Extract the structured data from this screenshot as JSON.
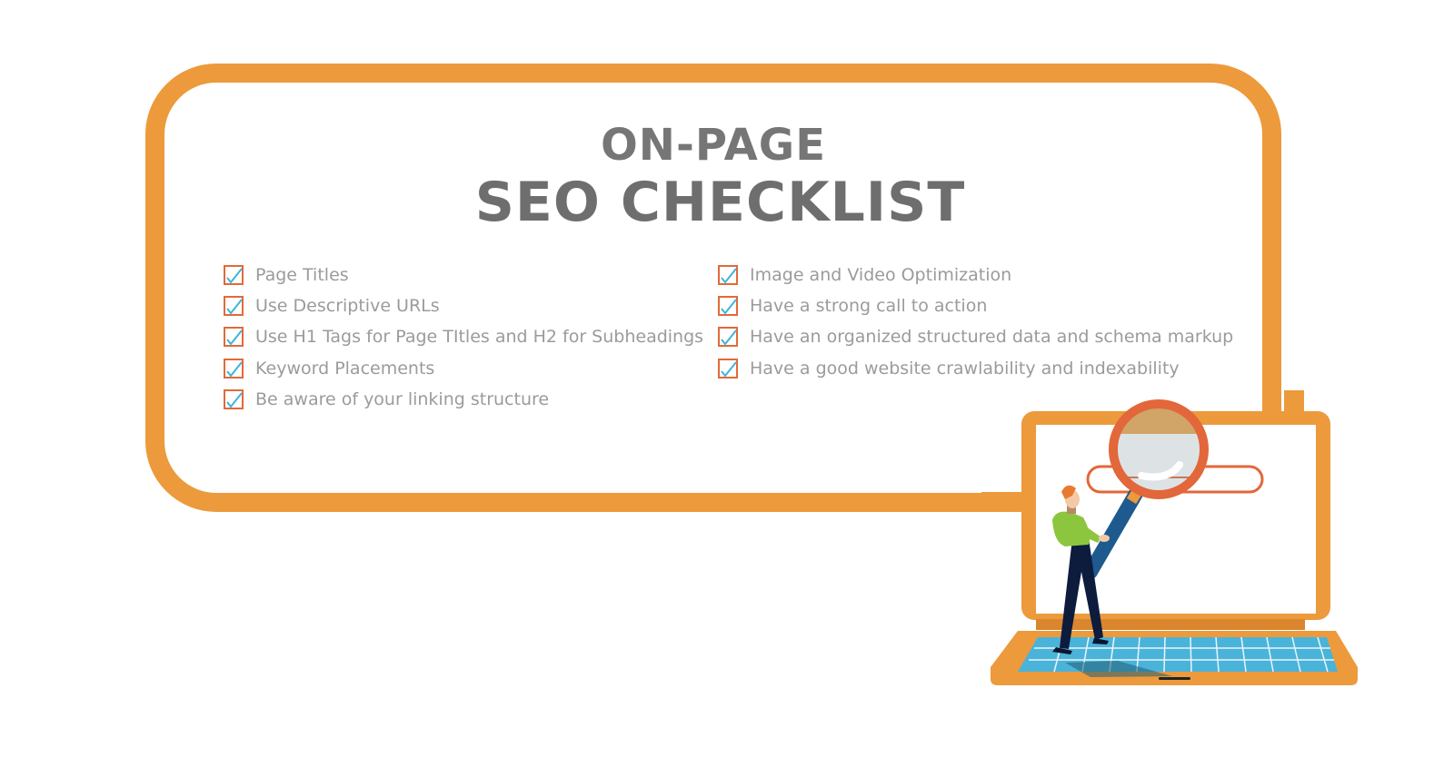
{
  "header": {
    "line1": "ON-PAGE",
    "line2": "SEO CHECKLIST"
  },
  "checklist": {
    "left": [
      {
        "label": "Page Titles",
        "checked": true
      },
      {
        "label": "Use Descriptive URLs",
        "checked": true
      },
      {
        "label": "Use H1 Tags for Page TItles and H2 for Subheadings",
        "checked": true
      },
      {
        "label": "Keyword Placements",
        "checked": true
      },
      {
        "label": "Be aware of your linking structure",
        "checked": true
      }
    ],
    "right": [
      {
        "label": "Image and Video Optimization",
        "checked": true
      },
      {
        "label": "Have a strong call to action",
        "checked": true
      },
      {
        "label": "Have an organized structured data and schema markup",
        "checked": true
      },
      {
        "label": "Have a good website crawlability and indexability",
        "checked": true
      }
    ]
  },
  "illustration": {
    "subject": "person-with-magnifying-glass-on-laptop",
    "icons": [
      "checkbox-checked-icon",
      "laptop-icon",
      "magnifying-glass-icon",
      "search-bar-icon",
      "person-figure"
    ]
  },
  "colors": {
    "frame_orange": "#ec9a3c",
    "checkbox_border": "#e26a38",
    "checkmark_blue": "#3fb3dc",
    "title_gray": "#6e6e6e",
    "text_gray": "#9b9b9b",
    "keyboard_blue": "#4ab3d9",
    "magnifier_ring": "#e2673a"
  }
}
